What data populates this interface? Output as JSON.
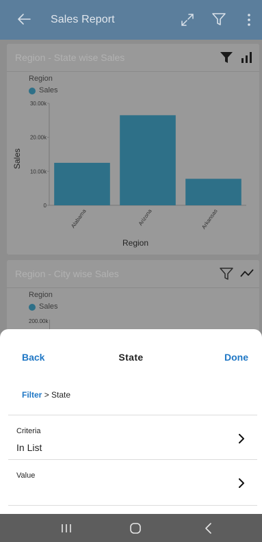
{
  "appbar": {
    "title": "Sales Report",
    "icons": [
      "back-arrow-icon",
      "expand-icon",
      "filter-icon",
      "more-vertical-icon"
    ]
  },
  "cards": [
    {
      "title": "Region - State wise Sales",
      "icons": [
        "filter-filled-icon",
        "bar-chart-icon"
      ],
      "legend_title": "Region",
      "legend_series": "Sales"
    },
    {
      "title": "Region - City wise Sales",
      "icons": [
        "filter-outline-icon",
        "line-chart-icon"
      ],
      "legend_title": "Region",
      "legend_series": "Sales",
      "visible_ytick": "200.00k"
    }
  ],
  "chart_data": {
    "type": "bar",
    "categories": [
      "Alabama",
      "Arizona",
      "Arkansas"
    ],
    "series": [
      {
        "name": "Sales",
        "values": [
          12500,
          26500,
          7800
        ]
      }
    ],
    "xlabel": "Region",
    "ylabel": "Sales",
    "yticks": [
      "0",
      "10.00k",
      "20.00k",
      "30.00k"
    ],
    "ylim": [
      0,
      30000
    ],
    "bar_color": "#2e7088"
  },
  "sheet": {
    "back_label": "Back",
    "title": "State",
    "done_label": "Done",
    "breadcrumb": {
      "link": "Filter",
      "separator": ">",
      "current": "State"
    },
    "rows": [
      {
        "label": "Criteria",
        "value": "In List"
      },
      {
        "label": "Value",
        "value": ""
      }
    ],
    "accent_color": "#1f77c5"
  },
  "navbar": {
    "icons": [
      "recent-apps-icon",
      "home-icon",
      "back-icon"
    ]
  }
}
